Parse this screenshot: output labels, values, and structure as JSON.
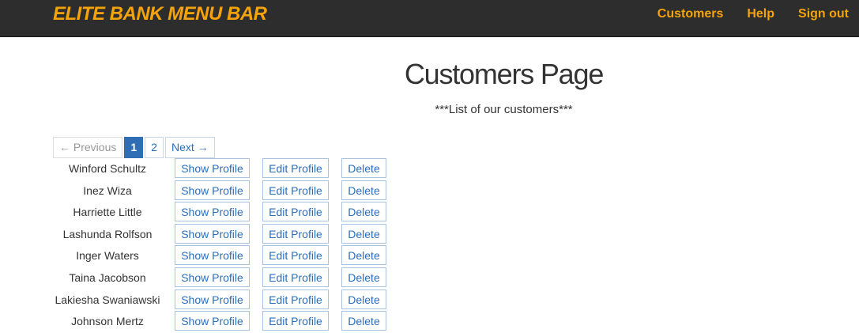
{
  "navbar": {
    "brand": "ELITE BANK MENU BAR",
    "links": {
      "customers": "Customers",
      "help": "Help",
      "signout": "Sign out"
    },
    "accent_color": "#f5a30a",
    "background_color": "#2d2d2d"
  },
  "main": {
    "title": "Customers Page",
    "subtitle": "***List of our customers***"
  },
  "pagination": {
    "previous": "← Previous",
    "pages": [
      "1",
      "2"
    ],
    "active_page": "1",
    "next": "Next →"
  },
  "customers": [
    {
      "name": "Winford Schultz"
    },
    {
      "name": "Inez Wiza"
    },
    {
      "name": "Harriette Little"
    },
    {
      "name": "Lashunda Rolfson"
    },
    {
      "name": "Inger Waters"
    },
    {
      "name": "Taina Jacobson"
    },
    {
      "name": "Lakiesha Swaniawski"
    },
    {
      "name": "Johnson Mertz"
    }
  ],
  "actions": {
    "show": "Show Profile",
    "edit": "Edit Profile",
    "delete": "Delete"
  }
}
